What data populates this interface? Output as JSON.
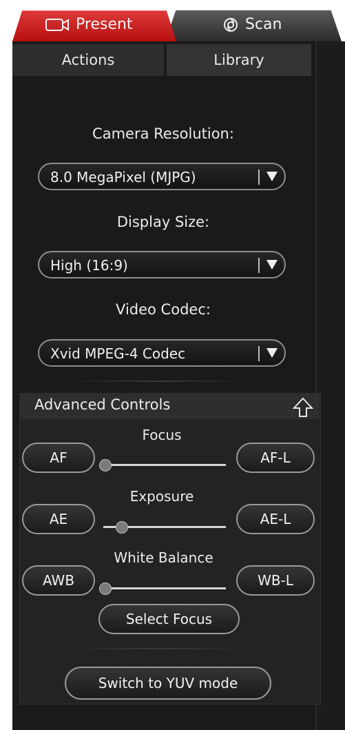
{
  "tabs": {
    "present": "Present",
    "scan": "Scan"
  },
  "subtabs": {
    "actions": "Actions",
    "library": "Library"
  },
  "camera": {
    "resolution_label": "Camera Resolution:",
    "resolution_value": "8.0 MegaPixel (MJPG)",
    "display_label": "Display Size:",
    "display_value": "High (16:9)",
    "codec_label": "Video Codec:",
    "codec_value": "Xvid MPEG-4 Codec"
  },
  "advanced": {
    "title": "Advanced Controls",
    "focus": {
      "label": "Focus",
      "left": "AF",
      "right": "AF-L",
      "level": 0.0
    },
    "exposure": {
      "label": "Exposure",
      "left": "AE",
      "right": "AE-L",
      "level": 0.15
    },
    "wb": {
      "label": "White Balance",
      "left": "AWB",
      "right": "WB-L",
      "level": 0.0
    },
    "select_focus": "Select Focus",
    "switch_mode": "Switch to YUV mode"
  },
  "colors": {
    "active_tab": "#c8201f",
    "panel_bg": "#1a1a1a"
  }
}
